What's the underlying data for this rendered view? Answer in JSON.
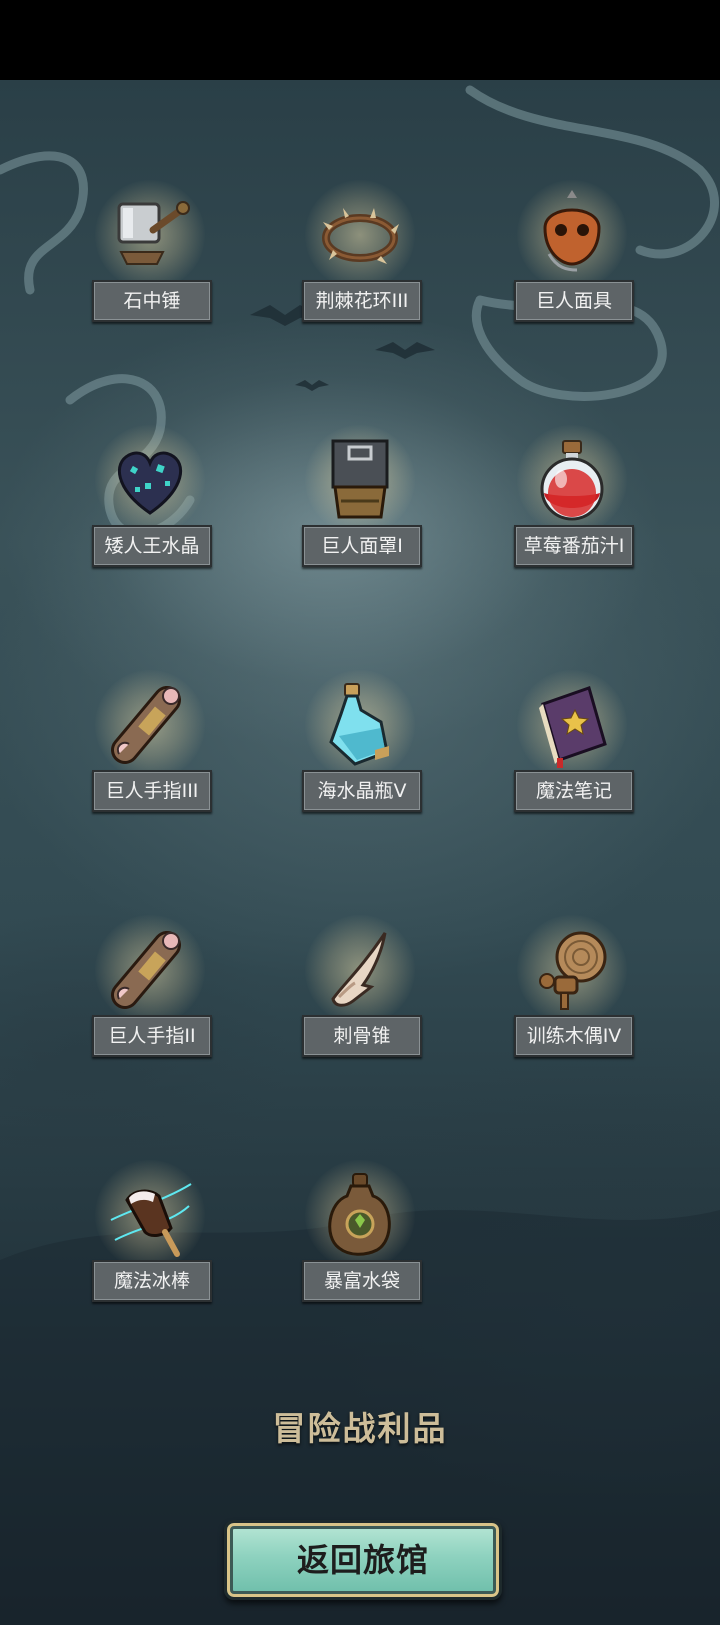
{
  "page": {
    "title": "冒险战利品"
  },
  "items": [
    {
      "name": "石中锤",
      "icon": "hammer-icon"
    },
    {
      "name": "荆棘花环III",
      "icon": "thorn-wreath-icon"
    },
    {
      "name": "巨人面具",
      "icon": "giant-mask-icon"
    },
    {
      "name": "矮人王水晶",
      "icon": "crystal-heart-icon"
    },
    {
      "name": "巨人面罩I",
      "icon": "giant-visor-icon"
    },
    {
      "name": "草莓番茄汁I",
      "icon": "red-potion-icon"
    },
    {
      "name": "巨人手指III",
      "icon": "giant-finger-icon"
    },
    {
      "name": "海水晶瓶V",
      "icon": "blue-bottle-icon"
    },
    {
      "name": "魔法笔记",
      "icon": "magic-book-icon"
    },
    {
      "name": "巨人手指II",
      "icon": "giant-finger-icon"
    },
    {
      "name": "刺骨锥",
      "icon": "bone-spike-icon"
    },
    {
      "name": "训练木偶IV",
      "icon": "training-dummy-icon"
    },
    {
      "name": "魔法冰棒",
      "icon": "magic-popsicle-icon"
    },
    {
      "name": "暴富水袋",
      "icon": "water-pouch-icon"
    }
  ],
  "actions": {
    "back_label": "返回旅馆"
  }
}
